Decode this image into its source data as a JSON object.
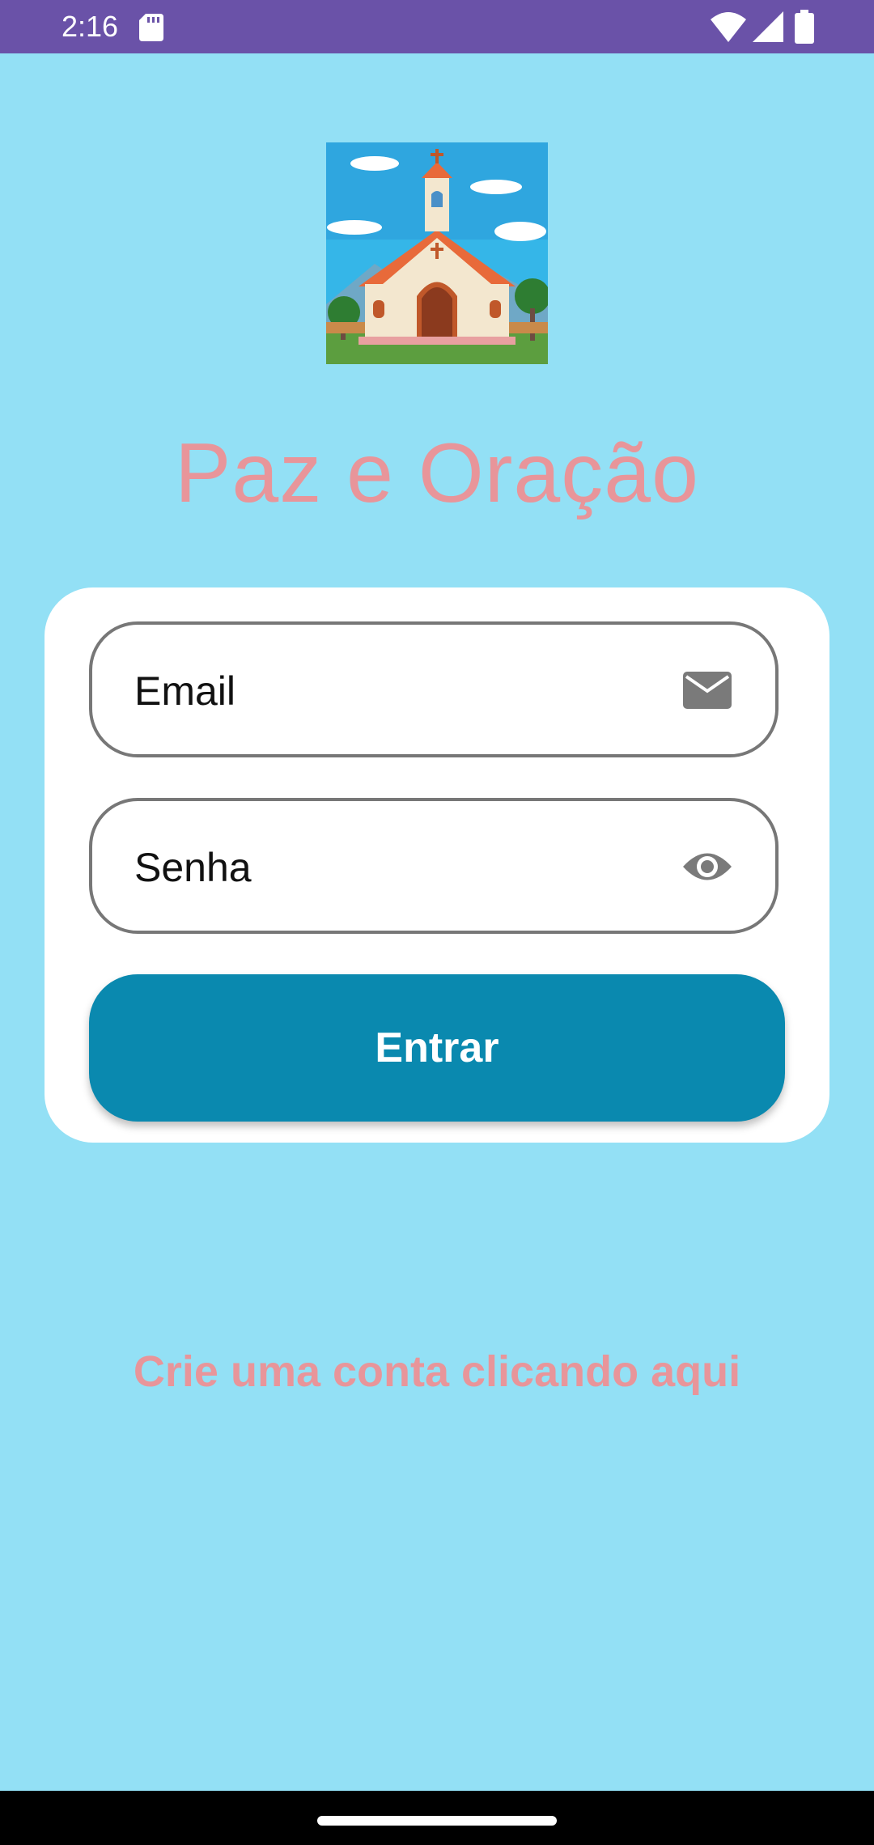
{
  "status_bar": {
    "time": "2:16",
    "icons": [
      "sd-card-icon",
      "wifi-icon",
      "signal-icon",
      "battery-icon"
    ]
  },
  "app": {
    "logo_icon": "church-icon",
    "title": "Paz e Oração"
  },
  "login_form": {
    "email_placeholder": "Email",
    "email_icon": "mail-icon",
    "password_placeholder": "Senha",
    "password_icon": "eye-icon",
    "submit_label": "Entrar"
  },
  "signup": {
    "link_text": "Crie uma conta clicando aqui"
  },
  "colors": {
    "background": "#93E0F5",
    "status_bar": "#6A52A8",
    "title": "#E8959A",
    "button": "#0A89AF",
    "card": "#FFFFFF"
  }
}
